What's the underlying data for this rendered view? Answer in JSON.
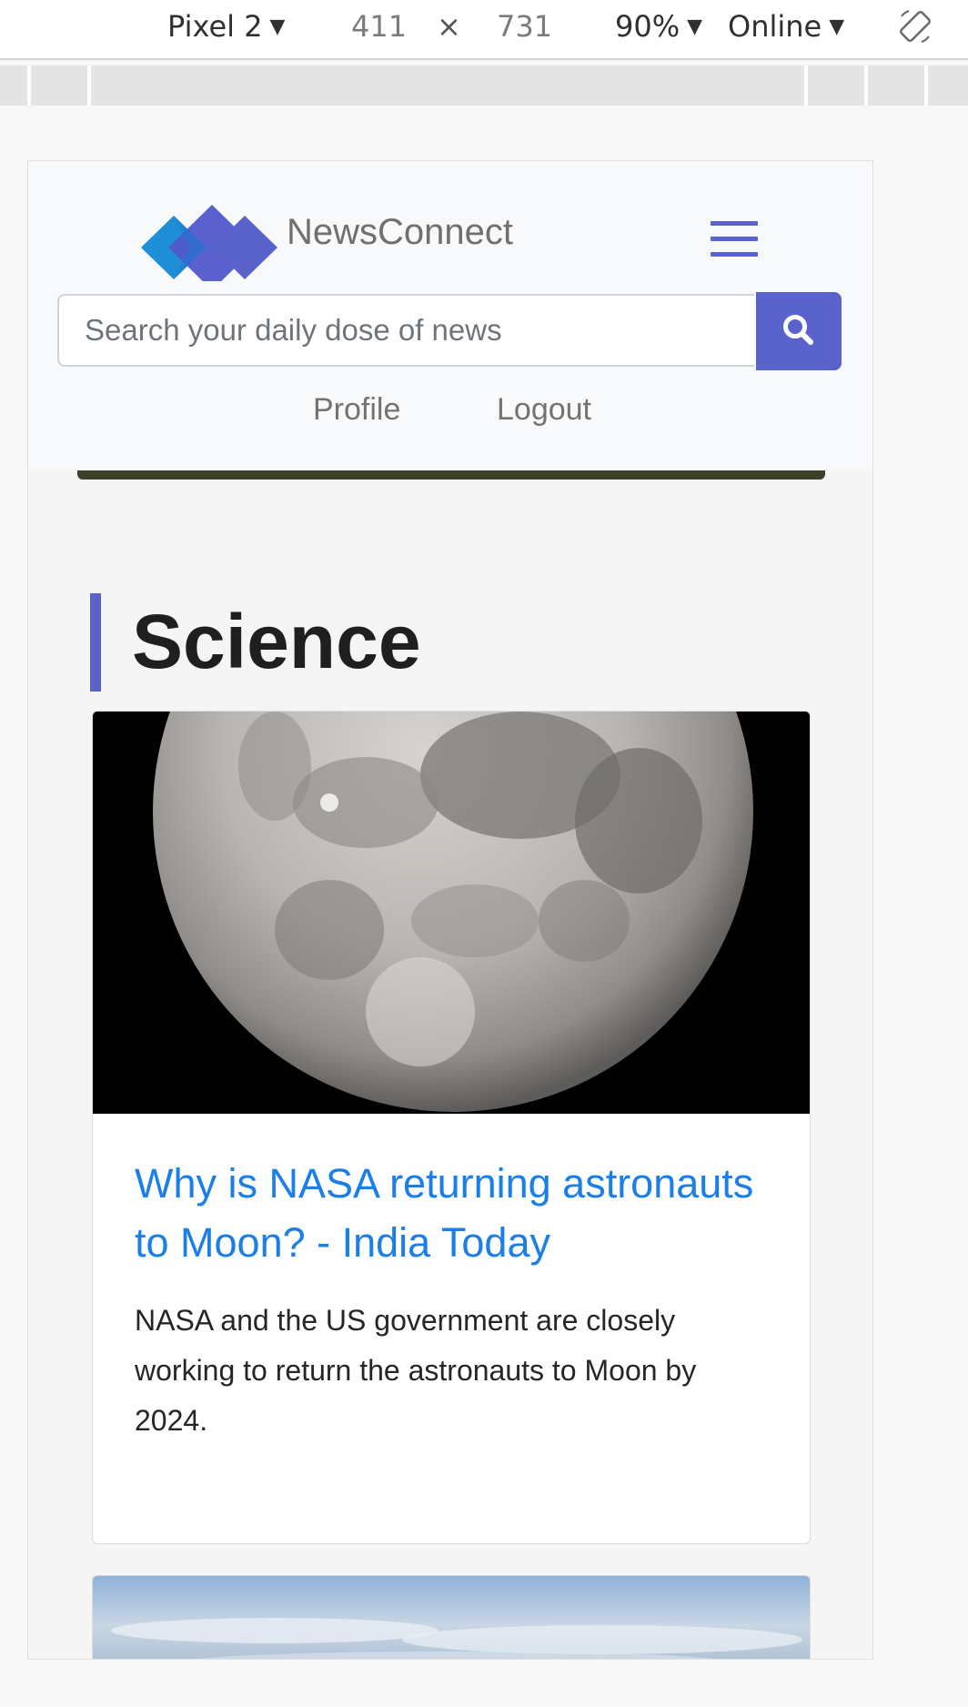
{
  "devtools": {
    "device": "Pixel 2",
    "width": "411",
    "times": "×",
    "height": "731",
    "zoom": "90%",
    "network": "Online",
    "caret": "▼"
  },
  "site": {
    "brand": "NewsConnect",
    "accent_color": "#5a62cc",
    "search": {
      "placeholder": "Search your daily dose of news"
    },
    "nav": {
      "profile": "Profile",
      "logout": "Logout"
    }
  },
  "section": {
    "title": "Science"
  },
  "articles": [
    {
      "title": "Why is NASA returning astronauts to Moon? - India Today",
      "summary": "NASA and the US government are closely working to return the astronauts to Moon by 2024."
    }
  ]
}
